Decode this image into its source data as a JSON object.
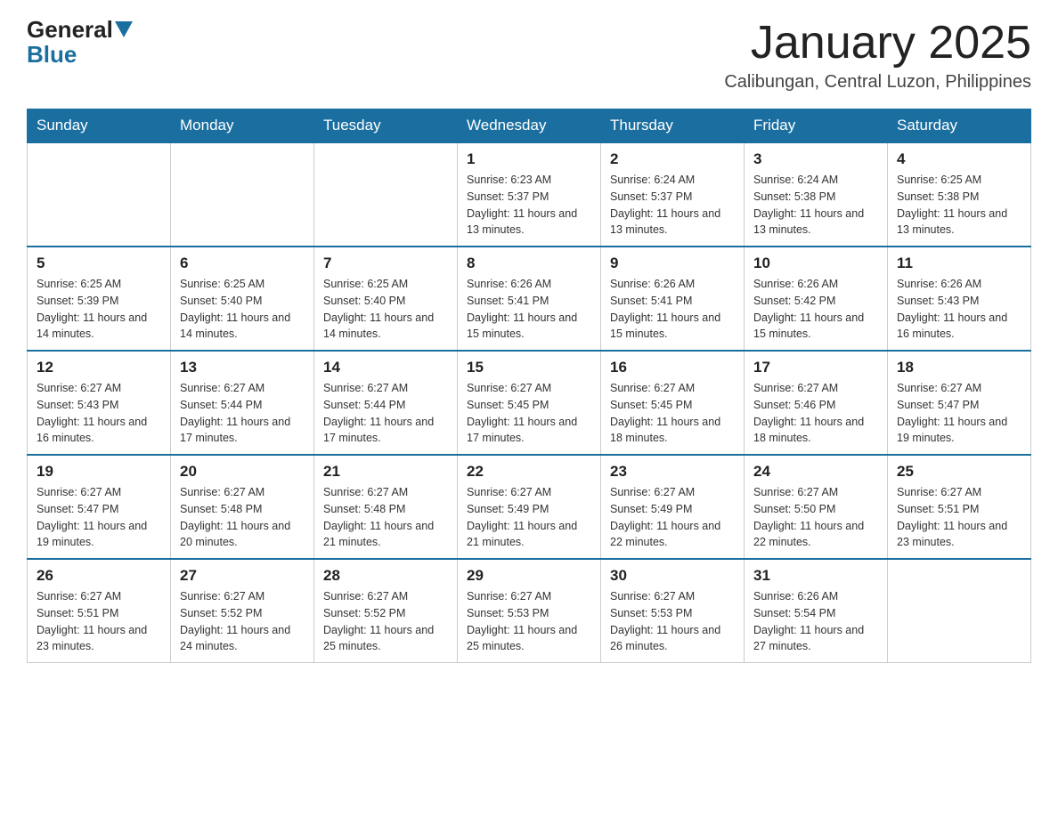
{
  "logo": {
    "general": "General",
    "blue": "Blue"
  },
  "title": "January 2025",
  "subtitle": "Calibungan, Central Luzon, Philippines",
  "headers": [
    "Sunday",
    "Monday",
    "Tuesday",
    "Wednesday",
    "Thursday",
    "Friday",
    "Saturday"
  ],
  "weeks": [
    [
      {
        "day": "",
        "info": ""
      },
      {
        "day": "",
        "info": ""
      },
      {
        "day": "",
        "info": ""
      },
      {
        "day": "1",
        "info": "Sunrise: 6:23 AM\nSunset: 5:37 PM\nDaylight: 11 hours and 13 minutes."
      },
      {
        "day": "2",
        "info": "Sunrise: 6:24 AM\nSunset: 5:37 PM\nDaylight: 11 hours and 13 minutes."
      },
      {
        "day": "3",
        "info": "Sunrise: 6:24 AM\nSunset: 5:38 PM\nDaylight: 11 hours and 13 minutes."
      },
      {
        "day": "4",
        "info": "Sunrise: 6:25 AM\nSunset: 5:38 PM\nDaylight: 11 hours and 13 minutes."
      }
    ],
    [
      {
        "day": "5",
        "info": "Sunrise: 6:25 AM\nSunset: 5:39 PM\nDaylight: 11 hours and 14 minutes."
      },
      {
        "day": "6",
        "info": "Sunrise: 6:25 AM\nSunset: 5:40 PM\nDaylight: 11 hours and 14 minutes."
      },
      {
        "day": "7",
        "info": "Sunrise: 6:25 AM\nSunset: 5:40 PM\nDaylight: 11 hours and 14 minutes."
      },
      {
        "day": "8",
        "info": "Sunrise: 6:26 AM\nSunset: 5:41 PM\nDaylight: 11 hours and 15 minutes."
      },
      {
        "day": "9",
        "info": "Sunrise: 6:26 AM\nSunset: 5:41 PM\nDaylight: 11 hours and 15 minutes."
      },
      {
        "day": "10",
        "info": "Sunrise: 6:26 AM\nSunset: 5:42 PM\nDaylight: 11 hours and 15 minutes."
      },
      {
        "day": "11",
        "info": "Sunrise: 6:26 AM\nSunset: 5:43 PM\nDaylight: 11 hours and 16 minutes."
      }
    ],
    [
      {
        "day": "12",
        "info": "Sunrise: 6:27 AM\nSunset: 5:43 PM\nDaylight: 11 hours and 16 minutes."
      },
      {
        "day": "13",
        "info": "Sunrise: 6:27 AM\nSunset: 5:44 PM\nDaylight: 11 hours and 17 minutes."
      },
      {
        "day": "14",
        "info": "Sunrise: 6:27 AM\nSunset: 5:44 PM\nDaylight: 11 hours and 17 minutes."
      },
      {
        "day": "15",
        "info": "Sunrise: 6:27 AM\nSunset: 5:45 PM\nDaylight: 11 hours and 17 minutes."
      },
      {
        "day": "16",
        "info": "Sunrise: 6:27 AM\nSunset: 5:45 PM\nDaylight: 11 hours and 18 minutes."
      },
      {
        "day": "17",
        "info": "Sunrise: 6:27 AM\nSunset: 5:46 PM\nDaylight: 11 hours and 18 minutes."
      },
      {
        "day": "18",
        "info": "Sunrise: 6:27 AM\nSunset: 5:47 PM\nDaylight: 11 hours and 19 minutes."
      }
    ],
    [
      {
        "day": "19",
        "info": "Sunrise: 6:27 AM\nSunset: 5:47 PM\nDaylight: 11 hours and 19 minutes."
      },
      {
        "day": "20",
        "info": "Sunrise: 6:27 AM\nSunset: 5:48 PM\nDaylight: 11 hours and 20 minutes."
      },
      {
        "day": "21",
        "info": "Sunrise: 6:27 AM\nSunset: 5:48 PM\nDaylight: 11 hours and 21 minutes."
      },
      {
        "day": "22",
        "info": "Sunrise: 6:27 AM\nSunset: 5:49 PM\nDaylight: 11 hours and 21 minutes."
      },
      {
        "day": "23",
        "info": "Sunrise: 6:27 AM\nSunset: 5:49 PM\nDaylight: 11 hours and 22 minutes."
      },
      {
        "day": "24",
        "info": "Sunrise: 6:27 AM\nSunset: 5:50 PM\nDaylight: 11 hours and 22 minutes."
      },
      {
        "day": "25",
        "info": "Sunrise: 6:27 AM\nSunset: 5:51 PM\nDaylight: 11 hours and 23 minutes."
      }
    ],
    [
      {
        "day": "26",
        "info": "Sunrise: 6:27 AM\nSunset: 5:51 PM\nDaylight: 11 hours and 23 minutes."
      },
      {
        "day": "27",
        "info": "Sunrise: 6:27 AM\nSunset: 5:52 PM\nDaylight: 11 hours and 24 minutes."
      },
      {
        "day": "28",
        "info": "Sunrise: 6:27 AM\nSunset: 5:52 PM\nDaylight: 11 hours and 25 minutes."
      },
      {
        "day": "29",
        "info": "Sunrise: 6:27 AM\nSunset: 5:53 PM\nDaylight: 11 hours and 25 minutes."
      },
      {
        "day": "30",
        "info": "Sunrise: 6:27 AM\nSunset: 5:53 PM\nDaylight: 11 hours and 26 minutes."
      },
      {
        "day": "31",
        "info": "Sunrise: 6:26 AM\nSunset: 5:54 PM\nDaylight: 11 hours and 27 minutes."
      },
      {
        "day": "",
        "info": ""
      }
    ]
  ]
}
